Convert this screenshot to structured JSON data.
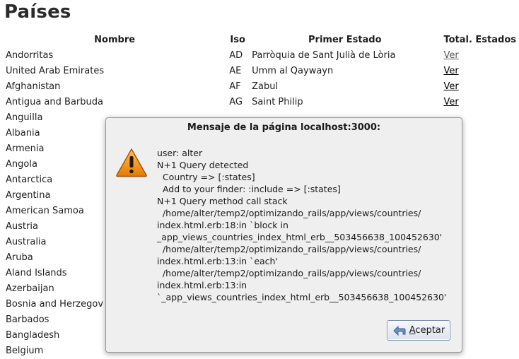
{
  "page": {
    "title": "Países"
  },
  "table": {
    "headers": {
      "name": "Nombre",
      "iso": "Iso",
      "first_state": "Primer Estado",
      "total": "Total. Estados"
    },
    "rows": [
      {
        "name": "Andorritas",
        "iso": "AD",
        "first_state": "Parròquia de Sant Julià de Lòria",
        "link": "Ver"
      },
      {
        "name": "United Arab Emirates",
        "iso": "AE",
        "first_state": "Umm al Qaywayn",
        "link": "Ver"
      },
      {
        "name": "Afghanistan",
        "iso": "AF",
        "first_state": "Zabul",
        "link": "Ver"
      },
      {
        "name": "Antigua and Barbuda",
        "iso": "AG",
        "first_state": "Saint Philip",
        "link": "Ver"
      },
      {
        "name": "Anguilla",
        "iso": "",
        "first_state": "",
        "link": ""
      },
      {
        "name": "Albania",
        "iso": "",
        "first_state": "",
        "link": ""
      },
      {
        "name": "Armenia",
        "iso": "",
        "first_state": "",
        "link": ""
      },
      {
        "name": "Angola",
        "iso": "",
        "first_state": "",
        "link": ""
      },
      {
        "name": "Antarctica",
        "iso": "",
        "first_state": "",
        "link": ""
      },
      {
        "name": "Argentina",
        "iso": "",
        "first_state": "",
        "link": ""
      },
      {
        "name": "American Samoa",
        "iso": "",
        "first_state": "",
        "link": ""
      },
      {
        "name": "Austria",
        "iso": "",
        "first_state": "",
        "link": ""
      },
      {
        "name": "Australia",
        "iso": "",
        "first_state": "",
        "link": ""
      },
      {
        "name": "Aruba",
        "iso": "",
        "first_state": "",
        "link": ""
      },
      {
        "name": "Aland Islands",
        "iso": "",
        "first_state": "",
        "link": ""
      },
      {
        "name": "Azerbaijan",
        "iso": "",
        "first_state": "",
        "link": ""
      },
      {
        "name": "Bosnia and Herzegov",
        "iso": "",
        "first_state": "",
        "link": ""
      },
      {
        "name": "Barbados",
        "iso": "",
        "first_state": "",
        "link": ""
      },
      {
        "name": "Bangladesh",
        "iso": "",
        "first_state": "",
        "link": ""
      },
      {
        "name": "Belgium",
        "iso": "",
        "first_state": "",
        "link": ""
      }
    ]
  },
  "dialog": {
    "title": "Mensaje de la página localhost:3000:",
    "icon": "warning-icon",
    "message_lines": [
      "user: alter",
      "N+1 Query detected",
      "  Country => [:states]",
      "  Add to your finder: :include => [:states]",
      "N+1 Query method call stack",
      "  /home/alter/temp2/optimizando_rails/app/views/countries/",
      "index.html.erb:18:in `block in",
      "_app_views_countries_index_html_erb__503456638_100452630'",
      "  /home/alter/temp2/optimizando_rails/app/views/countries/",
      "index.html.erb:13:in `each'",
      "  /home/alter/temp2/optimizando_rails/app/views/countries/",
      "index.html.erb:13:in",
      "`_app_views_countries_index_html_erb__503456638_100452630'"
    ],
    "accept_button": {
      "mnemonic": "A",
      "rest": "ceptar"
    }
  },
  "colors": {
    "warning": "#f08a00",
    "dialog_bg": "#efefef",
    "button_border": "#7b8fae"
  }
}
